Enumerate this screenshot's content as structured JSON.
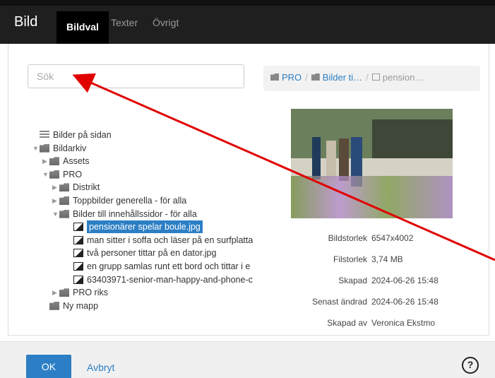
{
  "header": {
    "title": "Bild",
    "tabs": [
      {
        "label": "Bildval",
        "active": true
      },
      {
        "label": "Texter",
        "active": false
      },
      {
        "label": "Övrigt",
        "active": false
      }
    ]
  },
  "search": {
    "placeholder": "Sök"
  },
  "tree": {
    "items": [
      {
        "label": "Bilder på sidan",
        "icon": "stack-icon",
        "caret": ""
      },
      {
        "label": "Bildarkiv",
        "icon": "folder-icon",
        "caret": "▼"
      },
      {
        "label": "Assets",
        "icon": "folder-icon",
        "caret": "▶"
      },
      {
        "label": "PRO",
        "icon": "folder-icon",
        "caret": "▼"
      },
      {
        "label": "Distrikt",
        "icon": "folder-icon",
        "caret": "▶"
      },
      {
        "label": "Toppbilder generella - för alla",
        "icon": "folder-icon",
        "caret": "▶"
      },
      {
        "label": "Bilder till innehållssidor - för alla",
        "icon": "folder-icon",
        "caret": "▼"
      },
      {
        "label": "pensionärer spelar boule.jpg",
        "icon": "image-icon",
        "caret": "",
        "selected": true
      },
      {
        "label": "man sitter i soffa och läser på en surfplatta",
        "icon": "image-icon",
        "caret": ""
      },
      {
        "label": "två personer tittar på en dator.jpg",
        "icon": "image-icon",
        "caret": ""
      },
      {
        "label": "en grupp samlas runt ett bord och tittar i e",
        "icon": "image-icon",
        "caret": ""
      },
      {
        "label": "63403971-senior-man-happy-and-phone-c",
        "icon": "image-icon",
        "caret": ""
      },
      {
        "label": "PRO riks",
        "icon": "folder-icon",
        "caret": "▶"
      },
      {
        "label": "Ny mapp",
        "icon": "folder-icon",
        "caret": ""
      }
    ]
  },
  "breadcrumb": {
    "items": [
      "PRO",
      "Bilder ti…",
      "pension…"
    ],
    "separator": "/"
  },
  "details": {
    "rows": [
      {
        "key": "Bildstorlek",
        "value": "6547x4002"
      },
      {
        "key": "Filstorlek",
        "value": "3,74 MB"
      },
      {
        "key": "Skapad",
        "value": "2024-06-26 15:48"
      },
      {
        "key": "Senast ändrad",
        "value": "2024-06-26 15:48"
      },
      {
        "key": "Skapad av",
        "value": "Veronica Ekstmo"
      }
    ]
  },
  "footer": {
    "ok_label": "OK",
    "cancel_label": "Avbryt",
    "help_glyph": "?"
  },
  "colors": {
    "accent": "#2c7fc4",
    "header_bg": "#1f1f1f",
    "annotation_arrow": "#e00000"
  }
}
